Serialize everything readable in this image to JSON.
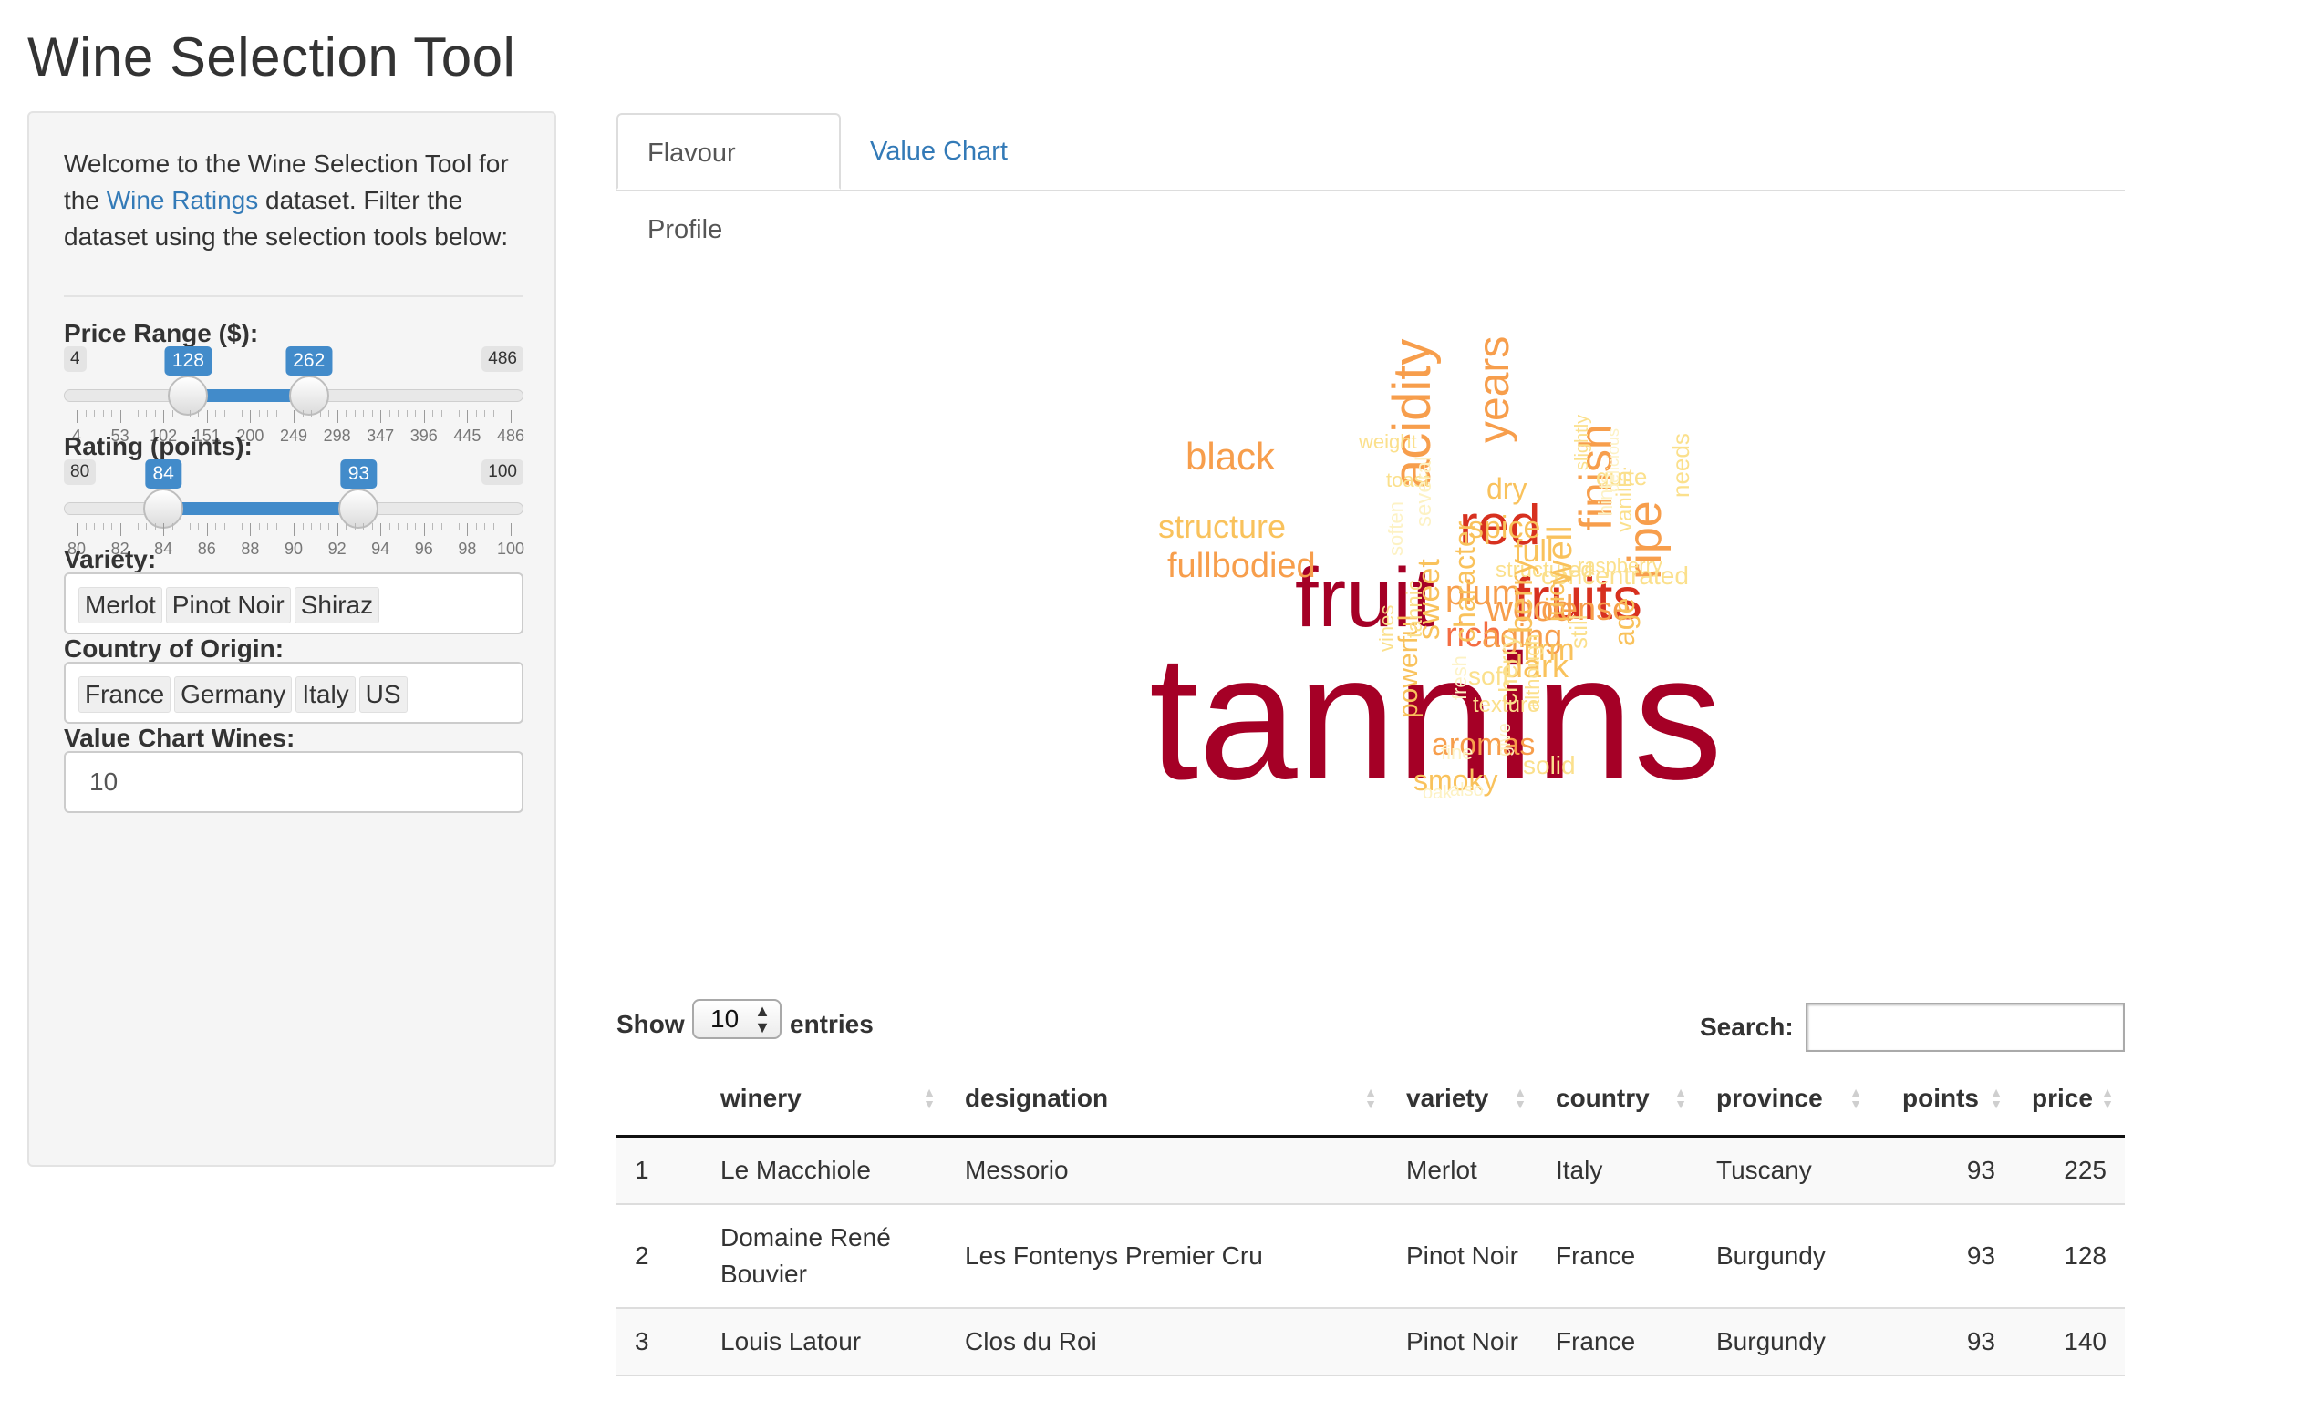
{
  "page": {
    "title": "Wine Selection Tool"
  },
  "sidebar": {
    "welcome_prefix": "Welcome to the Wine Selection Tool for the ",
    "welcome_link": "Wine Ratings",
    "welcome_suffix": " dataset. Filter the dataset using the selection tools below:",
    "price": {
      "label": "Price Range ($):",
      "min": 4,
      "max": 486,
      "low": 128,
      "high": 262,
      "grid": [
        "4",
        "53",
        "102",
        "151",
        "200",
        "249",
        "298",
        "347",
        "396",
        "445",
        "486"
      ]
    },
    "rating": {
      "label": "Rating (points):",
      "min": 80,
      "max": 100,
      "low": 84,
      "high": 93,
      "grid": [
        "80",
        "82",
        "84",
        "86",
        "88",
        "90",
        "92",
        "94",
        "96",
        "98",
        "100"
      ]
    },
    "variety": {
      "label": "Variety:",
      "selected": [
        "Merlot",
        "Pinot Noir",
        "Shiraz"
      ]
    },
    "country": {
      "label": "Country of Origin:",
      "selected": [
        "France",
        "Germany",
        "Italy",
        "US"
      ]
    },
    "value_chart": {
      "label": "Value Chart Wines:",
      "value": "10"
    }
  },
  "tabs": [
    {
      "label": "Flavour Profile",
      "active": true
    },
    {
      "label": "Value Chart",
      "active": false
    }
  ],
  "wordcloud": {
    "colors": {
      "darkred": "#a50026",
      "red": "#d7301f",
      "orange": "#f46d43",
      "amber": "#f79e4c",
      "gold": "#f9c25c",
      "yellow": "#fbe08c",
      "pale": "#fdf2c4"
    },
    "words": [
      "tannins",
      "fruit",
      "fruits",
      "red",
      "acidity",
      "years",
      "finish",
      "ripe",
      "black",
      "structure",
      "fullbodied",
      "wood",
      "rich",
      "plum",
      "aging",
      "dark",
      "firm",
      "dense",
      "full",
      "spice",
      "dry",
      "concentrated",
      "raspberry",
      "structured",
      "quite",
      "age",
      "berry",
      "character",
      "sweet",
      "well",
      "aromas",
      "smoky",
      "solid",
      "texture",
      "soft",
      "juicy",
      "cherry",
      "powerful",
      "still",
      "tannic",
      "vines",
      "needs",
      "vanilla",
      "slightly",
      "weight",
      "toast",
      "several",
      "soften",
      "fresh",
      "fine",
      "hints",
      "although",
      "delicious",
      "give",
      "also",
      "oak"
    ]
  },
  "table": {
    "show_label": "Show",
    "length": "10",
    "entries_label": "entries",
    "search_label": "Search:",
    "columns": [
      "",
      "winery",
      "designation",
      "variety",
      "country",
      "province",
      "points",
      "price"
    ],
    "rows": [
      [
        "1",
        "Le Macchiole",
        "Messorio",
        "Merlot",
        "Italy",
        "Tuscany",
        "93",
        "225"
      ],
      [
        "2",
        "Domaine René Bouvier",
        "Les Fontenys Premier Cru",
        "Pinot Noir",
        "France",
        "Burgundy",
        "93",
        "128"
      ],
      [
        "3",
        "Louis Latour",
        "Clos du Roi",
        "Pinot Noir",
        "France",
        "Burgundy",
        "93",
        "140"
      ]
    ]
  }
}
